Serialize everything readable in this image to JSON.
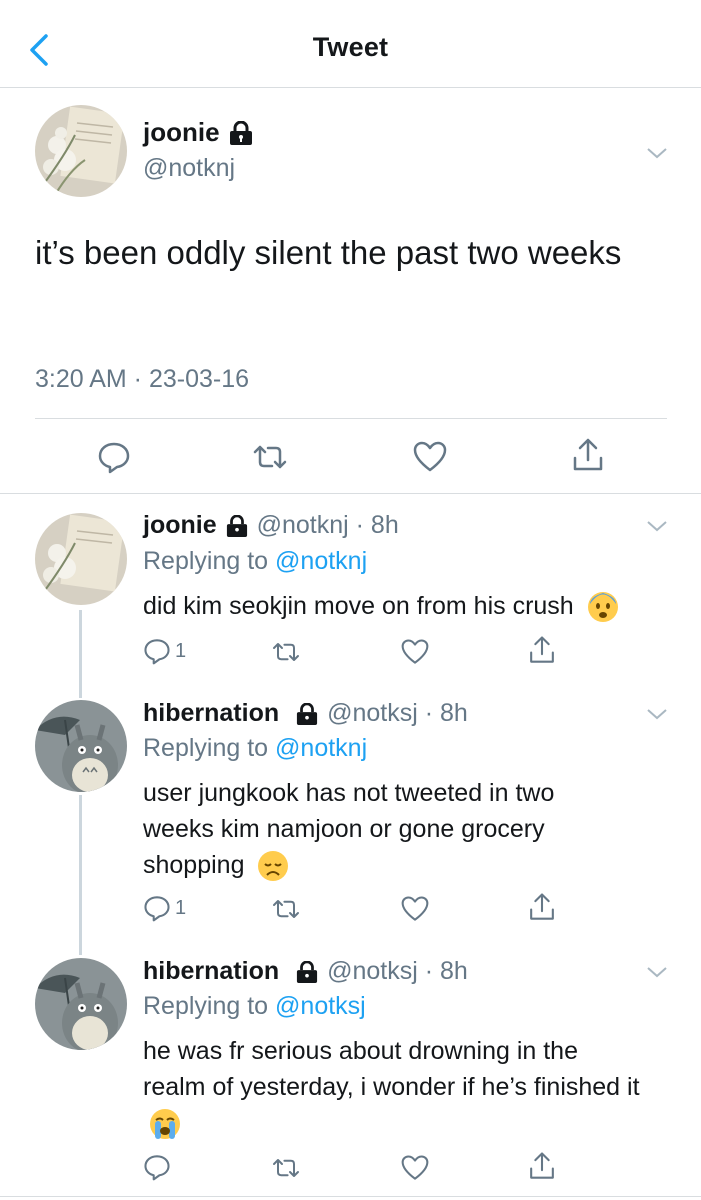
{
  "header": {
    "title": "Tweet"
  },
  "main_tweet": {
    "name": "joonie",
    "handle": "@notknj",
    "text": "it’s been oddly silent the past two weeks",
    "time": "3:20 AM · 23-03-16",
    "actions": [
      "comment-icon",
      "retweet-icon",
      "like-icon",
      "share-icon"
    ]
  },
  "replies": [
    {
      "name": "joonie",
      "handle": "@notknj · 8h",
      "replying_prefix": "Replying to",
      "replying_to": "@notknj",
      "text": "did kim seokjin move on from his crush",
      "emoji": "fearful-face",
      "reply_count": "1"
    },
    {
      "name": "hibernation",
      "handle": "@notksj · 8h",
      "replying_prefix": "Replying to",
      "replying_to": "@notknj",
      "text": "user jungkook has not tweeted in two weeks kim namjoon or gone grocery shopping",
      "emoji": "disappointed-face",
      "reply_count": "1"
    },
    {
      "name": "hibernation",
      "handle": "@notksj · 8h",
      "replying_prefix": "Replying to",
      "replying_to": "@notksj",
      "text": "he was fr serious about drowning in the realm of yesterday, i wonder if he’s finished it",
      "emoji": "crying-face",
      "reply_count": ""
    }
  ],
  "colors": {
    "accent": "#1da1f2",
    "muted": "#657786",
    "text": "#14171a",
    "divider": "#d9dde0"
  }
}
